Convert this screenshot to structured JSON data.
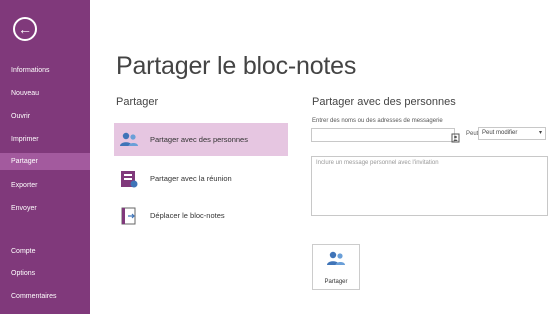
{
  "sidebar": {
    "back_icon": "back-arrow-icon",
    "items": [
      {
        "label": "Informations"
      },
      {
        "label": "Nouveau"
      },
      {
        "label": "Ouvrir"
      },
      {
        "label": "Imprimer"
      },
      {
        "label": "Partager"
      },
      {
        "label": "Exporter"
      },
      {
        "label": "Envoyer"
      },
      {
        "label": "Compte"
      },
      {
        "label": "Options"
      },
      {
        "label": "Commentaires"
      }
    ],
    "selected_index": 4
  },
  "main": {
    "title": "Partager le bloc-notes",
    "section_title": "Partager",
    "options": [
      {
        "label": "Partager avec des personnes",
        "icon": "people-share-icon"
      },
      {
        "label": "Partager avec la réunion",
        "icon": "meeting-share-icon"
      },
      {
        "label": "Déplacer le bloc-notes",
        "icon": "move-notebook-icon"
      }
    ]
  },
  "panel": {
    "title": "Partager avec des personnes",
    "field_label": "Entrer des noms ou des adresses de messagerie",
    "name_value": "",
    "permission_label": "Peut",
    "permission_value": "Peut modifier",
    "note_placeholder": "Inclure un message personnel avec l'invitation",
    "share_button_label": "Partager"
  },
  "colors": {
    "sidebar": "#80397b",
    "sidebar_selected": "#a35a9e",
    "option_selected": "#e6c6e1"
  }
}
